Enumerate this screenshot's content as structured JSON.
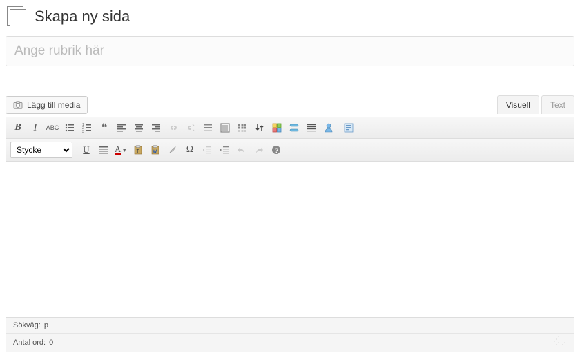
{
  "header": {
    "title": "Skapa ny sida"
  },
  "titleInput": {
    "placeholder": "Ange rubrik här",
    "value": ""
  },
  "media": {
    "addLabel": "Lägg till media"
  },
  "tabs": {
    "visual": "Visuell",
    "text": "Text",
    "active": "visual"
  },
  "formatSelect": {
    "value": "Stycke"
  },
  "status": {
    "pathLabel": "Sökväg:",
    "path": "p",
    "wordsLabel": "Antal ord:",
    "words": 0
  }
}
